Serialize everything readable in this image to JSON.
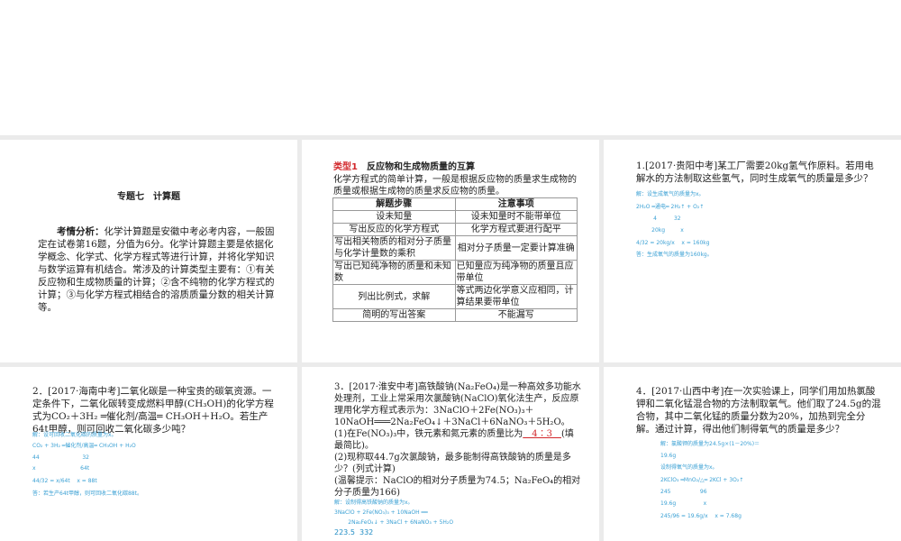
{
  "slide1": {
    "title": "专题七　计算题",
    "label": "考情分析：",
    "body": "化学计算题是安徽中考必考内容，一般固定在试卷第16题，分值为6分。化学计算题主要是依据化学概念、化学式、化学方程式等进行计算，并将化学知识与数学运算有机结合。常涉及的计算类型主要有：①有关反应物和生成物质量的计算；②含不纯物的化学方程式的计算；③与化学方程式相结合的溶质质量分数的相关计算等。"
  },
  "slide2": {
    "type_label": "类型1",
    "type_title": "　反应物和生成物质量的互算",
    "intro": "化学方程式的简单计算，一般是根据反应物的质量求生成物的质量或根据生成物的质量求反应物的质量。",
    "headers": [
      "解题步骤",
      "注意事项"
    ],
    "rows": [
      [
        "设未知量",
        "设未知量时不能带单位"
      ],
      [
        "写出反应的化学方程式",
        "化学方程式要进行配平"
      ],
      [
        "写出相关物质的相对分子质量与化学计量数的乘积",
        "相对分子质量一定要计算准确"
      ],
      [
        "写出已知纯净物的质量和未知数",
        "已知量应为纯净物的质量且应带单位"
      ],
      [
        "列出比例式，求解",
        "等式两边化学意义应相同，计算结果要带单位"
      ],
      [
        "简明的写出答案",
        "不能漏写"
      ]
    ]
  },
  "slide3": {
    "question": "1.[2017·贵阳中考]某工厂需要20kg氢气作原料。若用电解水的方法制取这些氢气，同时生成氧气的质量是多少？",
    "solution": [
      "解：设生成氧气的质量为x。",
      "2H₂O ═通电═ 2H₂↑ + O₂↑",
      "          4          32",
      "         20kg         x",
      "4/32 = 20kg/x    x = 160kg",
      "答：生成氧气的质量为160kg。"
    ]
  },
  "slide4": {
    "question": "2．[2017·海南中考]二氧化碳是一种宝贵的碳氧资源。一定条件下，二氧化碳转变成燃料甲醇(CH₃OH)的化学方程式为CO₂＋3H₂ ═催化剂/高温═ CH₃OH＋H₂O。若生产64t甲醇，则可回收二氧化碳多少吨？",
    "solution": [
      "解：设可回收二氧化碳的质量为x。",
      "CO₂ + 3H₂ ═催化剂/高温═ CH₃OH + H₂O",
      "44                         32",
      "x                          64t",
      "44/32 = x/64t    x = 88t",
      "答：若生产64t甲醇，则可回收二氧化碳88t。"
    ]
  },
  "slide5": {
    "question": "3．[2017·淮安中考]高铁酸钠(Na₂FeO₄)是一种高效多功能水处理剂，工业上常采用次氯酸钠(NaClO)氧化法生产，反应原理用化学方程式表示为：3NaClO＋2Fe(NO₃)₃＋10NaOH═══2Na₂FeO₄↓＋3NaCl＋6NaNO₃＋5H₂O。",
    "part1": "(1)在Fe(NO₃)₃中，铁元素和氮元素的质量比为",
    "answer1": "　4∶3　",
    "part1_tail": "(填最简比)。",
    "part2": "(2)现称取44.7g次氯酸钠，最多能制得高铁酸钠的质量是多少？(列式计算)",
    "hint": "(温馨提示：NaClO的相对分子质量为74.5；Na₂FeO₄的相对分子质量为166)",
    "solution": [
      "解：设制得高铁酸钠的质量为x。",
      "3NaClO + 2Fe(NO₃)₃ + 10NaOH ══",
      "        2Na₂FeO₄↓ + 3NaCl + 6NaNO₃ + 5H₂O",
      "223.5  332"
    ]
  },
  "slide6": {
    "question": "4．[2017·山西中考]在一次实验课上，同学们用加热氯酸钾和二氧化锰混合物的方法制取氧气。他们取了24.5g的混合物，其中二氧化锰的质量分数为20%，加热到完全分解。通过计算，得出他们制得氧气的质量是多少？",
    "solution": [
      "解：氯酸钾的质量为24.5g×(1－20%)＝",
      "19.6g",
      "设制得氧气的质量为x。",
      "2KClO₃ ═MnO₂/△═ 2KCl + 3O₂↑",
      "245                 96",
      "19.6g                x",
      "245/96 = 19.6g/x    x = 7.68g"
    ]
  }
}
